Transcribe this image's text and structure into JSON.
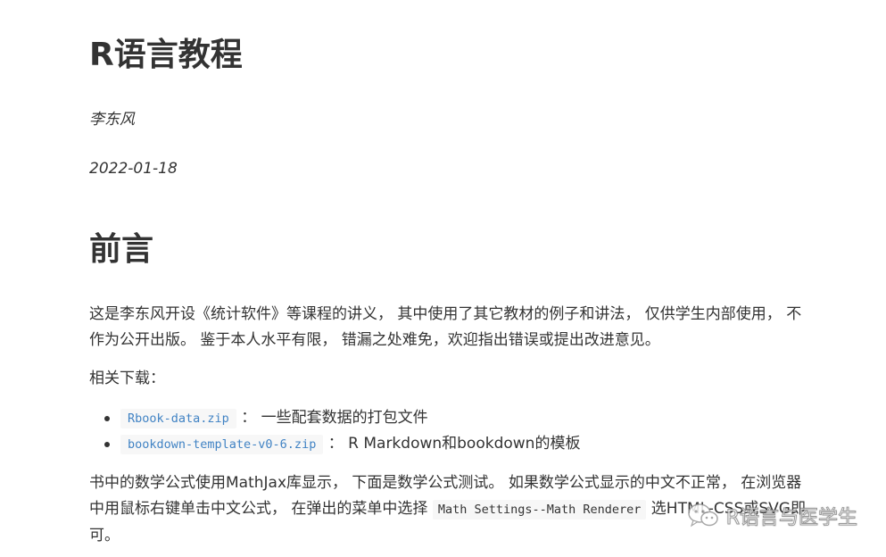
{
  "document": {
    "title": "R语言教程",
    "author": "李东风",
    "date": "2022-01-18",
    "section_heading": "前言",
    "intro": {
      "line1": "这是李东风开设《统计软件》等课程的讲义， 其中使用了其它教材的例子和讲法， 仅供学生内部使用， 不",
      "line2": "作为公开出版。 鉴于本人水平有限， 错漏之处难免，欢迎指出错误或提出改进意见。"
    },
    "downloads_label": "相关下载：",
    "downloads": [
      {
        "file": "Rbook-data.zip",
        "desc": "： 一些配套数据的打包文件"
      },
      {
        "file": "bookdown-template-v0-6.zip",
        "desc": "： R Markdown和bookdown的模板"
      }
    ],
    "math_note": {
      "line1": "书中的数学公式使用MathJax库显示， 下面是数学公式测试。 如果数学公式显示的中文不正常， 在浏览器",
      "line2_before": "中用鼠标右键单击中文公式， 在弹出的菜单中选择 ",
      "line2_code": "Math Settings--Math Renderer",
      "line2_after": " 选HTML-CSS或SVG即",
      "line3": "可。"
    }
  },
  "watermark": {
    "text": "R语言与医学生",
    "icon": "wechat-icon"
  }
}
